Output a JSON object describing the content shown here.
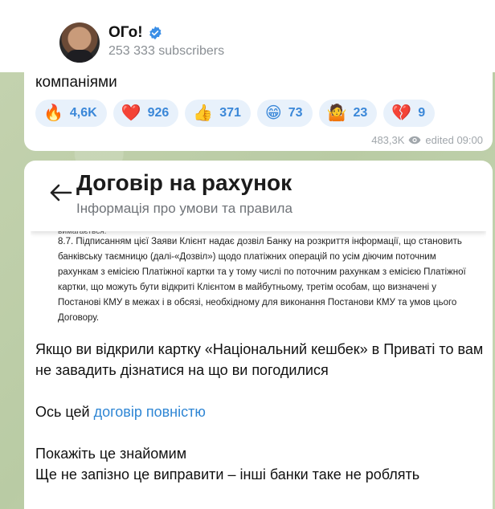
{
  "channel": {
    "title": "ОГо!",
    "subscribers": "253 333 subscribers"
  },
  "message1": {
    "text_tail": "компаніями",
    "reactions": [
      {
        "emoji": "🔥",
        "icon": "fire-emoji",
        "count": "4,6K"
      },
      {
        "emoji": "❤️",
        "icon": "heart-emoji",
        "count": "926"
      },
      {
        "emoji": "👍",
        "icon": "thumbs-up-emoji",
        "count": "371"
      },
      {
        "emoji": "😁",
        "icon": "grin-emoji",
        "count": "73"
      },
      {
        "emoji": "🤷",
        "icon": "shrug-emoji",
        "count": "23"
      },
      {
        "emoji": "💔",
        "icon": "broken-heart-emoji",
        "count": "9"
      }
    ],
    "views": "483,3K",
    "edited": "edited 09:00"
  },
  "message2": {
    "document": {
      "title": "Договір на рахунок",
      "subtitle": "Інформація про умови та правила",
      "partial_line": "вимагається.",
      "clause": "8.7. Підписанням цієї Заяви Клієнт надає дозвіл Банку на розкриття інформації, що становить банківську таємницю (далі-«Дозвіл») щодо платіжних операцій по усім діючим поточним рахункам з емісією Платіжної картки та у тому числі по поточним рахункам з емісією Платіжної картки, що можуть бути відкриті Клієнтом в майбутньому, третім особам, що визначені у Постанові КМУ в межах і в обсязі, необхідному для виконання Постанови КМУ та умов цього Договору."
    },
    "para1": "Якщо ви відкрили картку «Національний кешбек» в Приваті то вам не завадить дізнатися на що ви погодилися",
    "para2_prefix": "Ось цей ",
    "para2_link": "договір повністю",
    "para3_line1": "Покажіть це знайомим",
    "para3_line2": "Ще не запізно це виправити – інші банки таке не роблять"
  },
  "colors": {
    "accent": "#3a87d8",
    "verified": "#3a8ee6",
    "reaction_bg": "#e8f1fb"
  }
}
